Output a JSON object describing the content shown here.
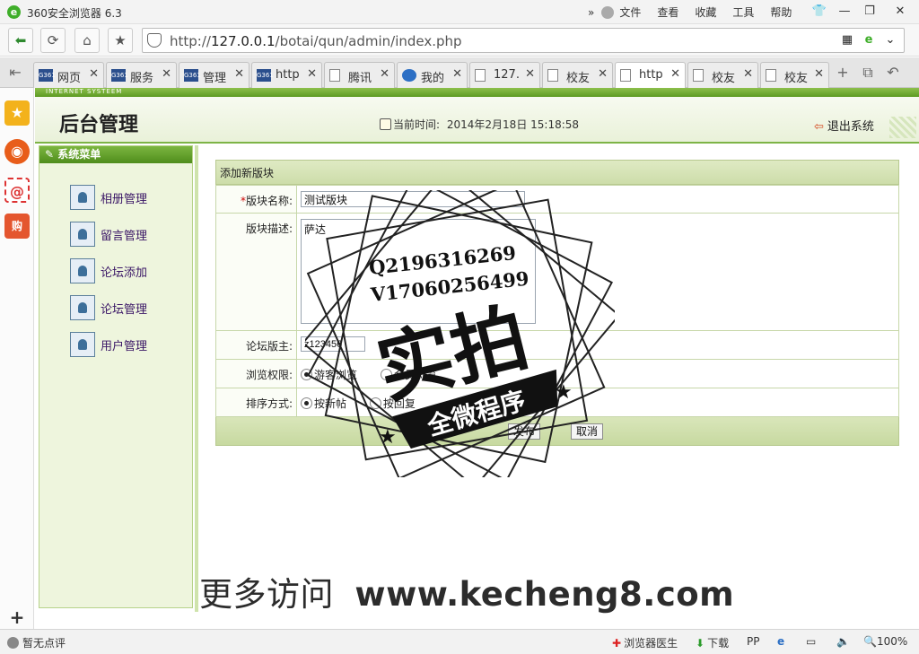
{
  "browser": {
    "title": "360安全浏览器 6.3",
    "menus": [
      "文件",
      "查看",
      "收藏",
      "工具",
      "帮助"
    ],
    "address": {
      "scheme": "http://",
      "host": "127.0.0.1",
      "path": "/botai/qun/admin/index.php"
    },
    "tabs": [
      {
        "label": "网页",
        "icon": "G361"
      },
      {
        "label": "服务",
        "icon": "G361"
      },
      {
        "label": "管理",
        "icon": "G361"
      },
      {
        "label": "http",
        "icon": "G361"
      },
      {
        "label": "腾讯",
        "icon": "doc"
      },
      {
        "label": "我的",
        "icon": "ie"
      },
      {
        "label": "127.",
        "icon": "doc"
      },
      {
        "label": "校友",
        "icon": "doc"
      },
      {
        "label": "http",
        "icon": "doc",
        "active": true
      },
      {
        "label": "校友",
        "icon": "doc"
      },
      {
        "label": "校友",
        "icon": "doc"
      }
    ]
  },
  "status": {
    "comment": "暂无点评",
    "doctor": "浏览器医生",
    "download": "下载",
    "zoom": "100%"
  },
  "page": {
    "strip_text": "INTERNET SYSTEEM",
    "title": "后台管理",
    "time_label": "当前时间:",
    "time_value": "2014年2月18日 15:18:58",
    "logout": "退出系统"
  },
  "menu": {
    "title": "系统菜单",
    "items": [
      "相册管理",
      "留言管理",
      "论坛添加",
      "论坛管理",
      "用户管理"
    ]
  },
  "form": {
    "title": "添加新版块",
    "name_label": "版块名称:",
    "name_value": "测试版块",
    "desc_label": "版块描述:",
    "desc_value": "萨达",
    "admin_label": "论坛版主:",
    "admin_value": "z123456",
    "perm_label": "浏览权限:",
    "perm_options": [
      "游客浏览",
      "会员浏览"
    ],
    "sort_label": "排序方式:",
    "sort_options": [
      "按新帖",
      "按回复"
    ],
    "submit": "发布",
    "cancel": "取消"
  },
  "watermark": {
    "qq": "Q2196316269",
    "wechat": "V17060256499",
    "big": "实拍",
    "banner": "全微程序",
    "site_cn": "更多访问",
    "site_url": "www.kecheng8.com"
  },
  "colors": {
    "accent_green": "#5d9b23",
    "panel_bg": "#eef5dd",
    "menu_text": "#3a1666"
  }
}
